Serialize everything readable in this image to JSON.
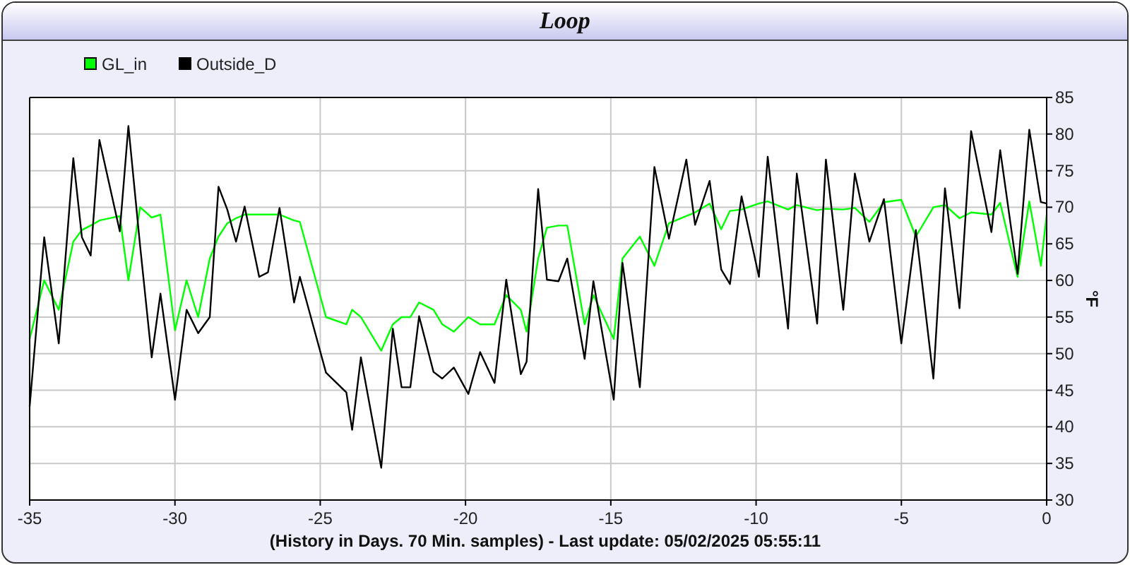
{
  "window": {
    "title": "Loop"
  },
  "chart_data": {
    "type": "line",
    "grid": true,
    "legend": "top-left",
    "xlabel": "(History in Days. 70 Min. samples) - Last update: 05/02/2025 05:55:11",
    "ylabel": "°F",
    "xlim": [
      -35,
      0
    ],
    "ylim": [
      30,
      85
    ],
    "xticks": [
      -35,
      -30,
      -25,
      -20,
      -15,
      -10,
      -5,
      0
    ],
    "yticks": [
      30,
      35,
      40,
      45,
      50,
      55,
      60,
      65,
      70,
      75,
      80,
      85
    ],
    "x": [
      -35,
      -34.5,
      -34,
      -33.5,
      -33.2,
      -32.9,
      -32.6,
      -31.9,
      -31.6,
      -31.2,
      -30.8,
      -30.5,
      -30,
      -29.6,
      -29.2,
      -28.8,
      -28.5,
      -28.2,
      -27.9,
      -27.6,
      -27.1,
      -26.8,
      -26.4,
      -25.9,
      -25.7,
      -24.8,
      -24.1,
      -23.9,
      -23.6,
      -22.9,
      -22.5,
      -22.2,
      -21.9,
      -21.6,
      -21.1,
      -20.8,
      -20.4,
      -19.9,
      -19.5,
      -19,
      -18.6,
      -18.1,
      -17.9,
      -17.5,
      -17.2,
      -16.8,
      -16.5,
      -15.9,
      -15.6,
      -14.9,
      -14.6,
      -14,
      -13.5,
      -13,
      -12.4,
      -12.1,
      -11.6,
      -11.2,
      -10.9,
      -10.5,
      -9.9,
      -9.6,
      -8.9,
      -8.6,
      -7.9,
      -7.6,
      -7,
      -6.6,
      -6.1,
      -5.6,
      -5,
      -4.5,
      -3.9,
      -3.5,
      -3,
      -2.6,
      -1.9,
      -1.6,
      -1,
      -0.6,
      -0.2,
      0
    ],
    "series": [
      {
        "name": "GL_in",
        "color": "#00ff00",
        "values": [
          52,
          60,
          56,
          65.3,
          66.9,
          67.5,
          68.2,
          68.8,
          60,
          70,
          68.6,
          69,
          53.2,
          60,
          55,
          63,
          66,
          67.8,
          68.5,
          69,
          69,
          69,
          69,
          68.2,
          68,
          55,
          54,
          56,
          55,
          50.4,
          54,
          55,
          55,
          57,
          56,
          54,
          53,
          55,
          54,
          54,
          58,
          56,
          53,
          63,
          67.2,
          67.5,
          67.5,
          54,
          58,
          52,
          63,
          66,
          62,
          67.8,
          68.8,
          69.3,
          70.5,
          67,
          69.5,
          69.7,
          70.5,
          70.8,
          69.7,
          70.3,
          69.6,
          69.8,
          69.7,
          69.9,
          68,
          70.7,
          71,
          66,
          70,
          70.3,
          68.5,
          69.3,
          69,
          70.6,
          60.5,
          70.8,
          62,
          69
        ]
      },
      {
        "name": "Outside_D",
        "color": "#000000",
        "values": [
          42.8,
          65.9,
          51.4,
          76.7,
          65.9,
          63.4,
          79.2,
          66.7,
          81.1,
          64.7,
          49.5,
          58.2,
          43.7,
          56,
          52.8,
          55,
          72.8,
          69.7,
          65.3,
          70.1,
          60.5,
          61.1,
          69.9,
          57,
          60.5,
          47.4,
          44.7,
          39.6,
          49.5,
          34.4,
          53.4,
          45.4,
          45.4,
          55.1,
          47.5,
          46.6,
          48.1,
          44.5,
          50.2,
          46,
          60.1,
          47.2,
          48.9,
          72.5,
          60.1,
          59.9,
          63,
          49.3,
          59.9,
          43.7,
          62.4,
          45.4,
          75.5,
          65.7,
          76.5,
          67.6,
          73.6,
          61.5,
          59.5,
          71.5,
          60.5,
          76.9,
          53.4,
          74.6,
          54.1,
          76.5,
          56,
          74.6,
          65.3,
          71.1,
          51.4,
          66.9,
          46.6,
          72.6,
          56.2,
          80.4,
          66.6,
          77.8,
          60.9,
          80.6,
          70.7,
          70.5
        ]
      }
    ]
  }
}
